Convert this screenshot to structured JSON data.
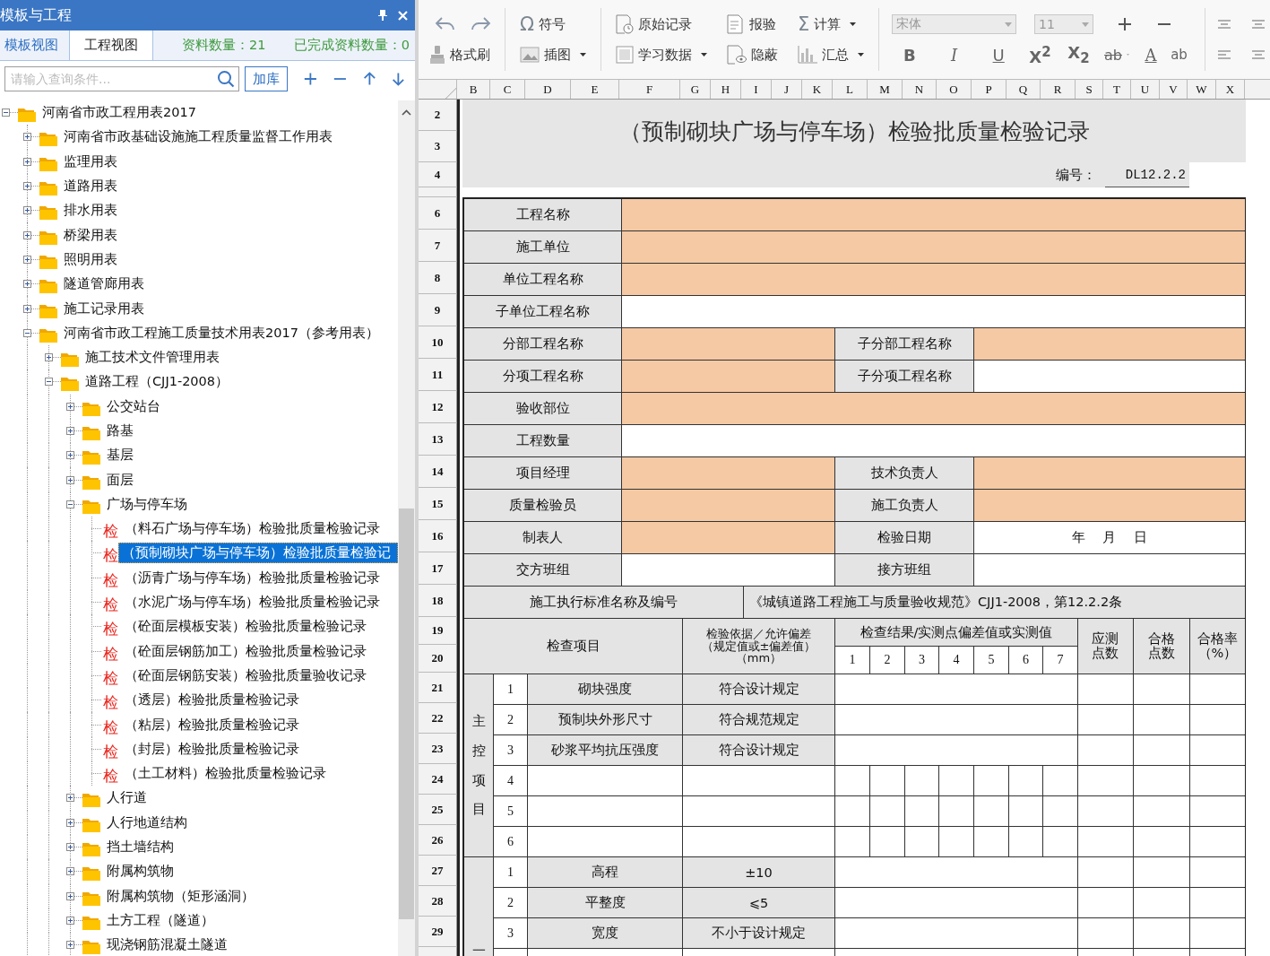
{
  "panel": {
    "title": "模板与工程",
    "tabs": [
      {
        "label": "模板视图",
        "selected": true
      },
      {
        "label": "工程视图",
        "selected": false
      }
    ],
    "stats": [
      "资料数量：21",
      "已完成资料数量：0"
    ],
    "search": {
      "placeholder": "请输入查询条件...",
      "button": "加库"
    },
    "tree": [
      {
        "kind": "folder",
        "label": "河南省市政工程用表2017",
        "expanded": true,
        "selected": false,
        "children": [
          {
            "kind": "folder",
            "label": "河南省市政基础设施施工程质量监督工作用表",
            "expanded": false,
            "selected": false
          },
          {
            "kind": "folder",
            "label": "监理用表",
            "expanded": false,
            "selected": false
          },
          {
            "kind": "folder",
            "label": "道路用表",
            "expanded": false,
            "selected": false
          },
          {
            "kind": "folder",
            "label": "排水用表",
            "expanded": false,
            "selected": false
          },
          {
            "kind": "folder",
            "label": "桥梁用表",
            "expanded": false,
            "selected": false
          },
          {
            "kind": "folder",
            "label": "照明用表",
            "expanded": false,
            "selected": false
          },
          {
            "kind": "folder",
            "label": "隧道管廊用表",
            "expanded": false,
            "selected": false
          },
          {
            "kind": "folder",
            "label": "施工记录用表",
            "expanded": false,
            "selected": false
          },
          {
            "kind": "folder",
            "label": "河南省市政工程施工质量技术用表2017（参考用表）",
            "expanded": true,
            "selected": false,
            "children": [
              {
                "kind": "folder",
                "label": "施工技术文件管理用表",
                "expanded": false,
                "selected": false
              },
              {
                "kind": "folder",
                "label": "道路工程（CJJ1-2008）",
                "expanded": true,
                "selected": false,
                "children": [
                  {
                    "kind": "folder",
                    "label": "公交站台",
                    "expanded": false,
                    "selected": false
                  },
                  {
                    "kind": "folder",
                    "label": "路基",
                    "expanded": false,
                    "selected": false
                  },
                  {
                    "kind": "folder",
                    "label": "基层",
                    "expanded": false,
                    "selected": false
                  },
                  {
                    "kind": "folder",
                    "label": "面层",
                    "expanded": false,
                    "selected": false
                  },
                  {
                    "kind": "folder",
                    "label": "广场与停车场",
                    "expanded": true,
                    "selected": false,
                    "children": [
                      {
                        "kind": "record",
                        "badge": "检",
                        "label": "（料石广场与停车场）检验批质量检验记录",
                        "selected": false
                      },
                      {
                        "kind": "record",
                        "badge": "检",
                        "label": "（预制砌块广场与停车场）检验批质量检验记",
                        "selected": true
                      },
                      {
                        "kind": "record",
                        "badge": "检",
                        "label": "（沥青广场与停车场）检验批质量检验记录",
                        "selected": false
                      },
                      {
                        "kind": "record",
                        "badge": "检",
                        "label": "（水泥广场与停车场）检验批质量检验记录",
                        "selected": false
                      },
                      {
                        "kind": "record",
                        "badge": "检",
                        "label": "（砼面层模板安装）检验批质量检验记录",
                        "selected": false
                      },
                      {
                        "kind": "record",
                        "badge": "检",
                        "label": "（砼面层钢筋加工）检验批质量检验记录",
                        "selected": false
                      },
                      {
                        "kind": "record",
                        "badge": "检",
                        "label": "（砼面层钢筋安装）检验批质量验收记录",
                        "selected": false
                      },
                      {
                        "kind": "record",
                        "badge": "检",
                        "label": "（透层）检验批质量检验记录",
                        "selected": false
                      },
                      {
                        "kind": "record",
                        "badge": "检",
                        "label": "（粘层）检验批质量检验记录",
                        "selected": false
                      },
                      {
                        "kind": "record",
                        "badge": "检",
                        "label": "（封层）检验批质量检验记录",
                        "selected": false
                      },
                      {
                        "kind": "record",
                        "badge": "检",
                        "label": "（土工材料）检验批质量检验记录",
                        "selected": false
                      }
                    ]
                  },
                  {
                    "kind": "folder",
                    "label": "人行道",
                    "expanded": false,
                    "selected": false
                  },
                  {
                    "kind": "folder",
                    "label": "人行地道结构",
                    "expanded": false,
                    "selected": false
                  },
                  {
                    "kind": "folder",
                    "label": "挡土墙结构",
                    "expanded": false,
                    "selected": false
                  },
                  {
                    "kind": "folder",
                    "label": "附属构筑物",
                    "expanded": false,
                    "selected": false
                  },
                  {
                    "kind": "folder",
                    "label": "附属构筑物（矩形涵洞）",
                    "expanded": false,
                    "selected": false
                  },
                  {
                    "kind": "folder",
                    "label": "土方工程（隧道）",
                    "expanded": false,
                    "selected": false
                  },
                  {
                    "kind": "folder",
                    "label": "现浇钢筋混凝土隧道",
                    "expanded": false,
                    "selected": false
                  }
                ]
              }
            ]
          }
        ]
      }
    ]
  },
  "toolbar": {
    "buttons": [
      {
        "glyph": "Ω",
        "label": "符号",
        "dropdown": false
      },
      {
        "label": "原始记录",
        "dropdown": false
      },
      {
        "label": "报验",
        "dropdown": false
      },
      {
        "glyph": "Σ",
        "label": "计算",
        "dropdown": true
      },
      {
        "label": "格式刷",
        "dropdown": false
      },
      {
        "label": "插图",
        "dropdown": true
      },
      {
        "label": "学习数据",
        "dropdown": true
      },
      {
        "label": "隐蔽",
        "dropdown": false
      },
      {
        "label": "汇总",
        "dropdown": true
      }
    ],
    "font": {
      "value": "宋体",
      "disabled": true
    },
    "size": {
      "value": "11",
      "disabled": true
    },
    "format": [
      {
        "label": "B"
      },
      {
        "label": "I"
      },
      {
        "label": "U"
      },
      {
        "label": "X$^{2}$"
      },
      {
        "label": "X$_{2}$"
      },
      {
        "label": "ab",
        "dropdown": true
      },
      {
        "label": "A"
      },
      {
        "label": "ab"
      }
    ]
  },
  "sheet": {
    "columns": [
      "B",
      "C",
      "D",
      "E",
      "F",
      "G",
      "H",
      "I",
      "J",
      "K",
      "L",
      "M",
      "N",
      "O",
      "P",
      "Q",
      "R",
      "S",
      "T",
      "U",
      "V",
      "W",
      "X"
    ],
    "row_numbers": [
      "2",
      "3",
      "4",
      "6",
      "7",
      "8",
      "9",
      "10",
      "11",
      "12",
      "13",
      "14",
      "15",
      "16",
      "17",
      "18",
      "19",
      "20",
      "21",
      "22",
      "23",
      "24",
      "25",
      "26",
      "27",
      "28",
      "29"
    ],
    "title": "（预制砌块广场与停车场）检验批质量检验记录",
    "number_label": "编号：",
    "number": "DL12.2.2",
    "info_rows": [
      {
        "kind": "single",
        "label": "工程名称",
        "highlighted": true
      },
      {
        "kind": "single",
        "label": "施工单位",
        "highlighted": true
      },
      {
        "kind": "single",
        "label": "单位工程名称",
        "highlighted": true
      },
      {
        "kind": "single",
        "label": "子单位工程名称",
        "highlighted": false
      },
      {
        "kind": "double",
        "label": "分部工程名称",
        "highlighted": true,
        "label_2": "子分部工程名称",
        "highlighted_2": true
      },
      {
        "kind": "double",
        "label": "分项工程名称",
        "highlighted": true,
        "label_2": "子分项工程名称",
        "highlighted_2": false
      },
      {
        "kind": "single",
        "label": "验收部位",
        "highlighted": true
      },
      {
        "kind": "single",
        "label": "工程数量",
        "highlighted": false
      },
      {
        "kind": "double",
        "label": "项目经理",
        "highlighted": true,
        "label_2": "技术负责人",
        "highlighted_2": true
      },
      {
        "kind": "double",
        "label": "质量检验员",
        "highlighted": true,
        "label_2": "施工负责人",
        "highlighted_2": true
      },
      {
        "kind": "double",
        "label": "制表人",
        "highlighted": true,
        "label_2": "检验日期",
        "highlighted_2": false,
        "value_2": "年　 月　 日"
      },
      {
        "kind": "double",
        "label": "交方班组",
        "highlighted": false,
        "label_2": "接方班组",
        "highlighted_2": false
      }
    ],
    "standard_label": "施工执行标准名称及编号",
    "standard_value": "《城镇道路工程施工与质量验收规范》CJJ1-2008，第12.2.2条",
    "header": {
      "item": "检查项目",
      "basis": "检验依据／允许偏差（规定值或±偏差值）（mm）",
      "results": "检查结果/实测点偏差值或实测值",
      "points": [
        "1",
        "2",
        "3",
        "4",
        "5",
        "6",
        "7"
      ],
      "required": "应测点数",
      "passed": "合格点数",
      "rate": "合格率（%）"
    },
    "check_groups": [
      {
        "label": "主控项目",
        "items": [
          {
            "no": "1",
            "name": "砌块强度",
            "basis": "符合设计规定",
            "kind": "merged"
          },
          {
            "no": "2",
            "name": "预制块外形尺寸",
            "basis": "符合规范规定",
            "kind": "merged"
          },
          {
            "no": "3",
            "name": "砂浆平均抗压强度",
            "basis": "符合设计规定",
            "kind": "merged"
          },
          {
            "no": "4",
            "kind": "points"
          },
          {
            "no": "5",
            "kind": "points"
          },
          {
            "no": "6",
            "kind": "points"
          }
        ]
      },
      {
        "label": "一",
        "items": [
          {
            "no": "1",
            "name": "高程",
            "basis": "±10",
            "kind": "merged"
          },
          {
            "no": "2",
            "name": "平整度",
            "basis": "⩽5",
            "kind": "merged"
          },
          {
            "no": "3",
            "name": "宽度",
            "basis": "不小于设计规定",
            "kind": "merged"
          }
        ]
      }
    ]
  }
}
